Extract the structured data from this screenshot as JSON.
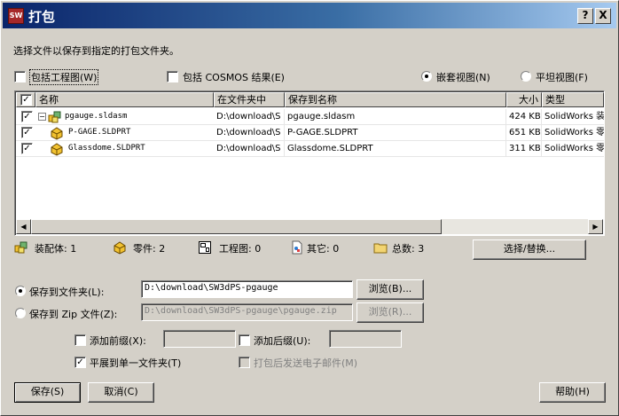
{
  "window": {
    "title": "打包",
    "app_icon_label": "SW",
    "help_btn": "?",
    "close_btn": "X"
  },
  "instruction": "选择文件以保存到指定的打包文件夹。",
  "options": {
    "include_drawings": "包括工程图(W)",
    "include_cosmos": "包括 COSMOS 结果(E)",
    "nested_view": "嵌套视图(N)",
    "flat_view": "平坦视图(F)"
  },
  "table": {
    "headers": [
      "名称",
      "在文件夹中",
      "保存到名称",
      "大小",
      "类型"
    ],
    "rows": [
      {
        "name": "pgauge.sldasm",
        "folder": "D:\\download\\S",
        "save_name": "pgauge.sldasm",
        "size": "424 KB",
        "type": "SolidWorks 装"
      },
      {
        "name": "P-GAGE.SLDPRT",
        "folder": "D:\\download\\S",
        "save_name": "P-GAGE.SLDPRT",
        "size": "651 KB",
        "type": "SolidWorks 零"
      },
      {
        "name": "Glassdome.SLDPRT",
        "folder": "D:\\download\\S",
        "save_name": "Glassdome.SLDPRT",
        "size": "311 KB",
        "type": "SolidWorks 零"
      }
    ]
  },
  "summary": {
    "assemblies": "装配体: 1",
    "parts": "零件: 2",
    "drawings": "工程图: 0",
    "other": "其它: 0",
    "total": "总数: 3",
    "select_replace": "选择/替换..."
  },
  "save_folder": {
    "label": "保存到文件夹(L):",
    "value": "D:\\download\\SW3dPS-pgauge",
    "browse": "浏览(B)..."
  },
  "save_zip": {
    "label": "保存到 Zip 文件(Z):",
    "value": "D:\\download\\SW3dPS-pgauge\\pgauge.zip",
    "browse": "浏览(R)..."
  },
  "extra": {
    "add_prefix": "添加前缀(X):",
    "add_suffix": "添加后缀(U):",
    "flatten": "平展到单一文件夹(T)",
    "email": "打包后发送电子邮件(M)"
  },
  "buttons": {
    "save": "保存(S)",
    "cancel": "取消(C)",
    "help": "帮助(H)"
  },
  "colors": {
    "titlebar_start": "#0a246a",
    "titlebar_end": "#a6caf0",
    "dialog_bg": "#d4d0c8"
  }
}
